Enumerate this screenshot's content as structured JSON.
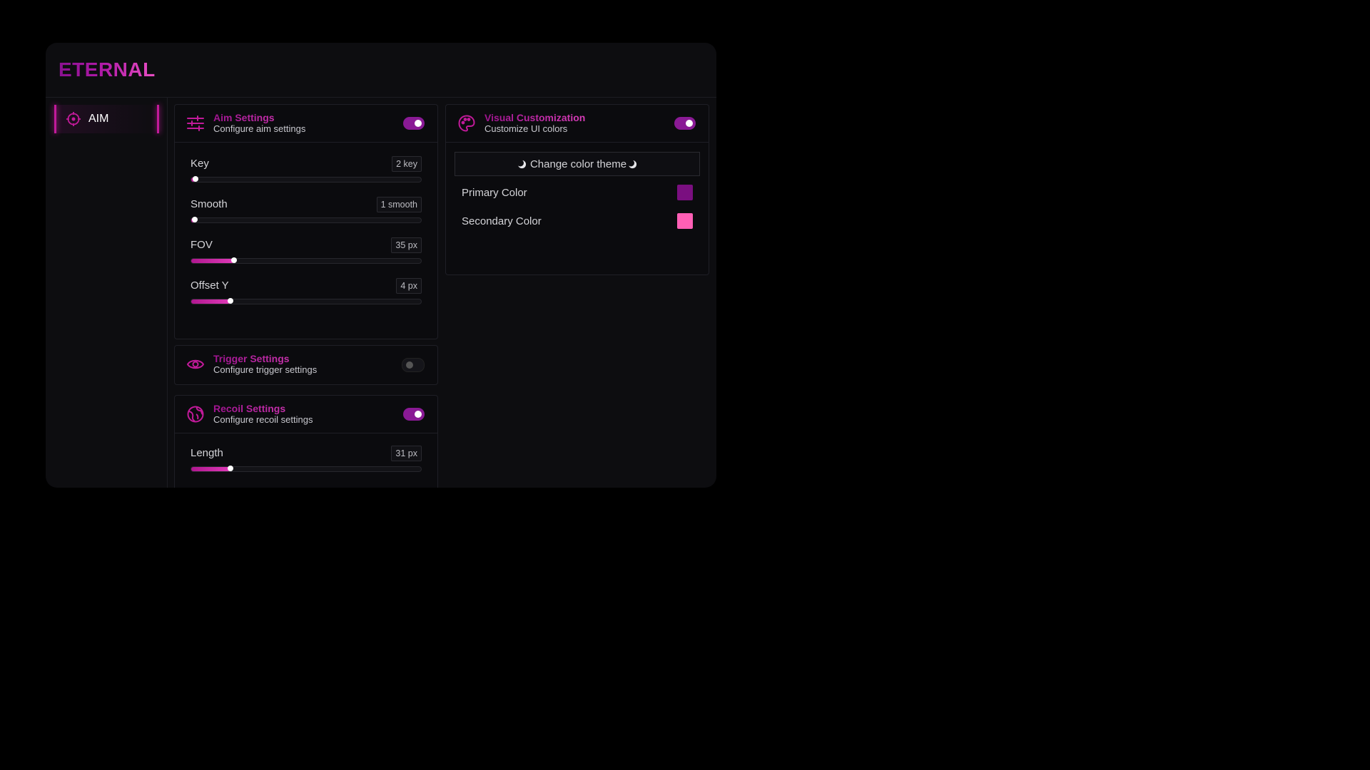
{
  "app": {
    "logo": "ETERNAL"
  },
  "sidebar": {
    "items": [
      {
        "label": "AIM",
        "icon": "crosshair-icon",
        "active": true
      }
    ]
  },
  "aim_settings": {
    "title": "Aim Settings",
    "subtitle": "Configure aim settings",
    "enabled": true,
    "sliders": [
      {
        "label": "Key",
        "value": "2 key",
        "fraction": 0.02
      },
      {
        "label": "Smooth",
        "value": "1 smooth",
        "fraction": 0.015
      },
      {
        "label": "FOV",
        "value": "35 px",
        "fraction": 0.185
      },
      {
        "label": "Offset Y",
        "value": "4 px",
        "fraction": 0.17
      }
    ]
  },
  "trigger_settings": {
    "title": "Trigger Settings",
    "subtitle": "Configure trigger settings",
    "enabled": false
  },
  "recoil_settings": {
    "title": "Recoil Settings",
    "subtitle": "Configure recoil settings",
    "enabled": true,
    "sliders": [
      {
        "label": "Length",
        "value": "31 px",
        "fraction": 0.17
      }
    ]
  },
  "visual": {
    "title": "Visual Customization",
    "subtitle": "Customize UI colors",
    "enabled": true,
    "theme_button": "Change color theme",
    "colors": [
      {
        "label": "Primary Color",
        "hex": "#7a0f80"
      },
      {
        "label": "Secondary Color",
        "hex": "#ff5fb5"
      }
    ]
  }
}
